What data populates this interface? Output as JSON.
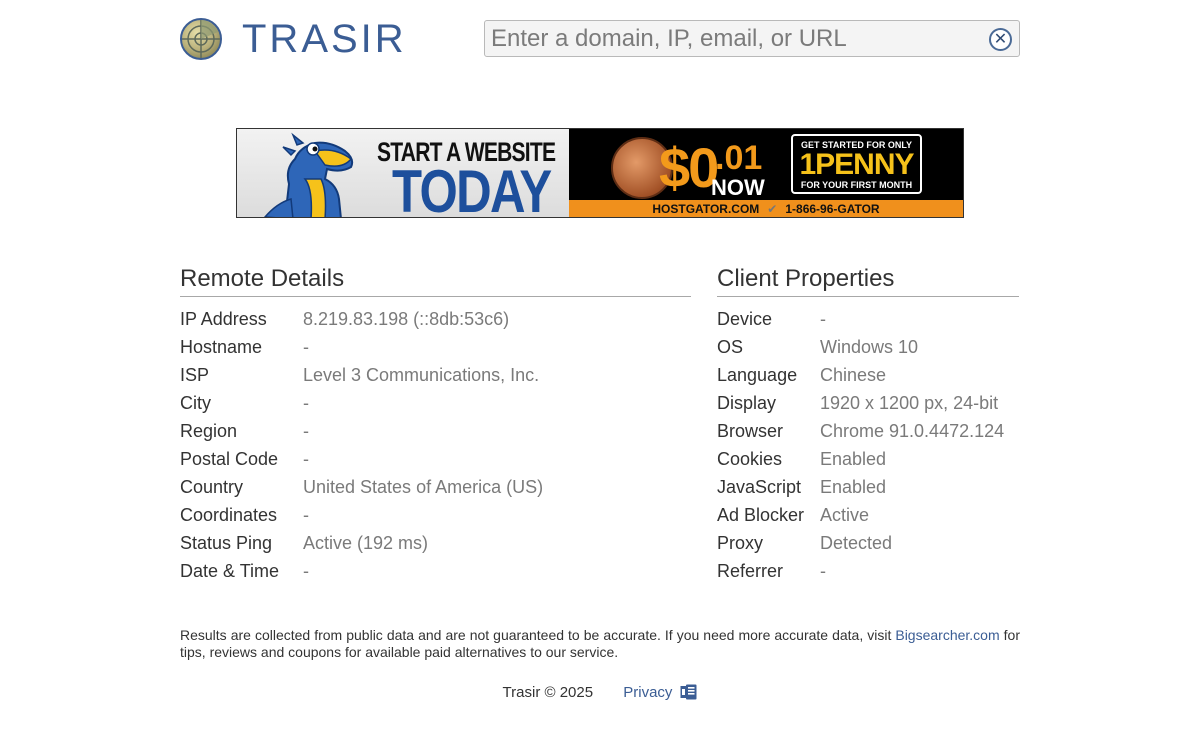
{
  "header": {
    "brand": "TRASIR",
    "search_placeholder": "Enter a domain, IP, email, or URL",
    "search_value": ""
  },
  "ad": {
    "headline_1": "START A WEBSITE",
    "headline_2": "TODAY",
    "price_dollar": "$0",
    "price_cents": ".01",
    "price_now": "NOW",
    "box_line_1": "GET STARTED FOR ONLY",
    "box_line_2": "1PENNY",
    "box_line_3": "FOR YOUR FIRST MONTH",
    "strip_site": "HOSTGATOR.COM",
    "strip_phone": "1-866-96-GATOR"
  },
  "remote": {
    "title": "Remote Details",
    "rows": [
      {
        "label": "IP Address",
        "value": "8.219.83.198 (::8db:53c6)"
      },
      {
        "label": "Hostname",
        "value": "-"
      },
      {
        "label": "ISP",
        "value": "Level 3 Communications, Inc."
      },
      {
        "label": "City",
        "value": "-"
      },
      {
        "label": "Region",
        "value": "-"
      },
      {
        "label": "Postal Code",
        "value": "-"
      },
      {
        "label": "Country",
        "value": "United States of America (US)"
      },
      {
        "label": "Coordinates",
        "value": "-"
      },
      {
        "label": "Status Ping",
        "value": "Active (192 ms)"
      },
      {
        "label": "Date & Time",
        "value": "-"
      }
    ]
  },
  "client": {
    "title": "Client Properties",
    "rows": [
      {
        "label": "Device",
        "value": "-"
      },
      {
        "label": "OS",
        "value": "Windows 10"
      },
      {
        "label": "Language",
        "value": "Chinese"
      },
      {
        "label": "Display",
        "value": "1920 x 1200 px, 24-bit"
      },
      {
        "label": "Browser",
        "value": "Chrome 91.0.4472.124"
      },
      {
        "label": "Cookies",
        "value": "Enabled"
      },
      {
        "label": "JavaScript",
        "value": "Enabled"
      },
      {
        "label": "Ad Blocker",
        "value": "Active"
      },
      {
        "label": "Proxy",
        "value": "Detected"
      },
      {
        "label": "Referrer",
        "value": "-"
      }
    ]
  },
  "footer": {
    "disclaimer_before": "Results are collected from public data and are not guaranteed to be accurate. If you need more accurate data, visit",
    "disclaimer_link": "Bigsearcher.com",
    "disclaimer_after": "for tips, reviews and coupons for available paid alternatives to our service.",
    "copyright": "Trasir © 2025",
    "privacy_label": "Privacy"
  },
  "colors": {
    "brand_blue": "#3b5d94",
    "value_gray": "#7a7a7a",
    "ad_orange": "#f0901c"
  },
  "icons": {
    "logo": "radar-globe-icon",
    "clear": "close-circle-icon",
    "privacy": "privacy-document-icon"
  }
}
